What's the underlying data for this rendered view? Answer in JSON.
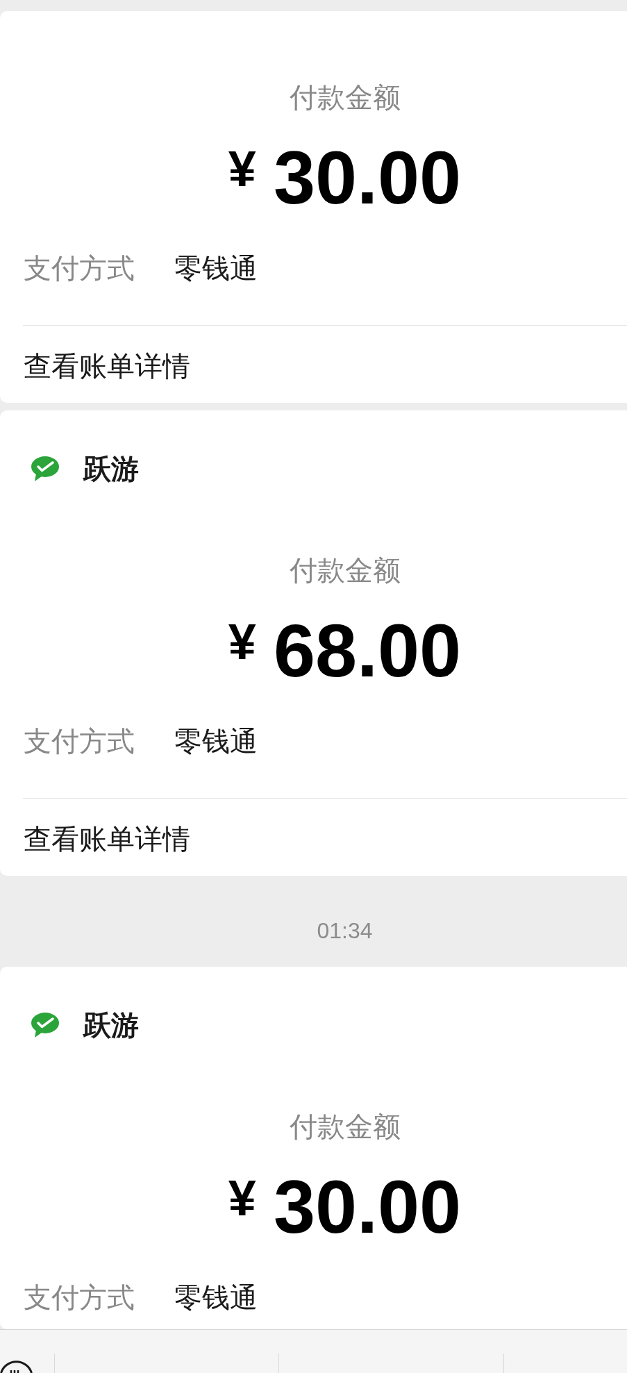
{
  "feed": [
    {
      "kind": "payment",
      "amount_label": "付款金额",
      "currency": "¥",
      "amount": "30.00",
      "method_label": "支付方式",
      "method": "零钱通",
      "details_link": "查看账单详情"
    },
    {
      "kind": "payment",
      "merchant": "跃游",
      "amount_label": "付款金额",
      "currency": "¥",
      "amount": "68.00",
      "method_label": "支付方式",
      "method": "零钱通",
      "details_link": "查看账单详情"
    },
    {
      "kind": "time",
      "text": "01:34"
    },
    {
      "kind": "payment",
      "merchant": "跃游",
      "amount_label": "付款金额",
      "currency": "¥",
      "amount": "30.00",
      "method_label": "支付方式",
      "method": "零钱通"
    }
  ]
}
